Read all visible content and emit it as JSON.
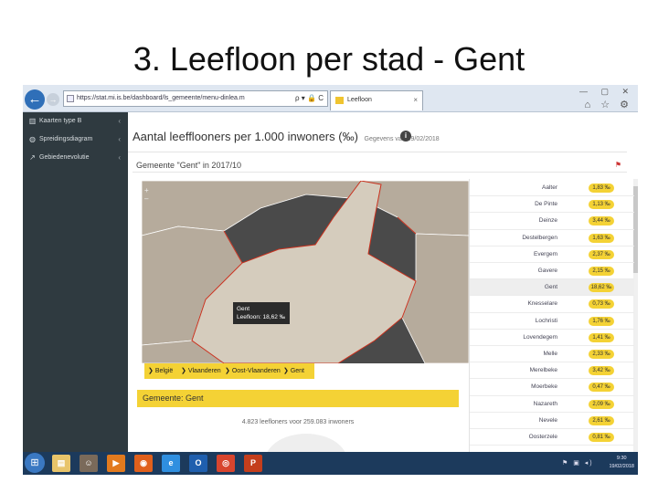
{
  "slide": {
    "title": "3. Leefloon per stad - Gent"
  },
  "browser": {
    "url": "https://stat.mi.is.be/dashboard/ls_gemeente/menu-dinlea.m",
    "tab_title": "Leefloon",
    "tab_close": "×",
    "url_tools": "ρ ▾ 🔒 C",
    "window_controls": "— ▢ ✕",
    "right_icons": "⌂ ☆ ⚙"
  },
  "sidebar": {
    "items": [
      {
        "icon": "map-icon",
        "label": "Kaarten type B"
      },
      {
        "icon": "gauge-icon",
        "label": "Spreidingsdiagram"
      },
      {
        "icon": "trend-icon",
        "label": "Gebiedenevolutie"
      }
    ]
  },
  "page": {
    "heading": "Aantal leefflooners per 1.000 inwoners (‰)",
    "subheading": "Gegevens van 19/02/2018",
    "panel_title": "Gemeente \"Gent\" in 2017/10"
  },
  "map": {
    "zoom_in": "+",
    "zoom_out": "–",
    "tooltip_line1": "Gent",
    "tooltip_line2": "Leefloon: 18,62 ‰",
    "colors": {
      "background": "#4a4a4a",
      "region": "#b6ab9c",
      "selected": "#d5ccbd",
      "border": "#c9311e"
    }
  },
  "breadcrumbs": [
    {
      "label": "België"
    },
    {
      "label": "Vlaanderen"
    },
    {
      "label": "Oost-Vlaanderen"
    },
    {
      "label": "Gent"
    }
  ],
  "region_bar": {
    "label": "Gemeente: Gent"
  },
  "summary": {
    "text": "4.823 leefloners voor 259.083 inwoners"
  },
  "table": {
    "rows": [
      {
        "city": "Aalter",
        "value": "1,83 ‰"
      },
      {
        "city": "De Pinte",
        "value": "1,13 ‰"
      },
      {
        "city": "Deinze",
        "value": "3,44 ‰"
      },
      {
        "city": "Destelbergen",
        "value": "1,63 ‰"
      },
      {
        "city": "Evergem",
        "value": "2,37 ‰"
      },
      {
        "city": "Gavere",
        "value": "2,15 ‰"
      },
      {
        "city": "Gent",
        "value": "18,62 ‰",
        "selected": true
      },
      {
        "city": "Knesselare",
        "value": "0,73 ‰"
      },
      {
        "city": "Lochristi",
        "value": "1,76 ‰"
      },
      {
        "city": "Lovendegem",
        "value": "1,41 ‰"
      },
      {
        "city": "Melle",
        "value": "2,33 ‰"
      },
      {
        "city": "Merelbeke",
        "value": "3,42 ‰"
      },
      {
        "city": "Moerbeke",
        "value": "0,47 ‰"
      },
      {
        "city": "Nazareth",
        "value": "2,09 ‰"
      },
      {
        "city": "Nevele",
        "value": "2,61 ‰"
      },
      {
        "city": "Oosterzele",
        "value": "0,81 ‰"
      }
    ]
  },
  "taskbar": {
    "apps": [
      {
        "name": "explorer",
        "glyph": "▤",
        "color": "#e8c46a"
      },
      {
        "name": "user",
        "glyph": "☺",
        "color": "#7a6a5a"
      },
      {
        "name": "media",
        "glyph": "▶",
        "color": "#e27a1e"
      },
      {
        "name": "firefox",
        "glyph": "◉",
        "color": "#e0601c"
      },
      {
        "name": "ie",
        "glyph": "e",
        "color": "#2f8fe0"
      },
      {
        "name": "outlook",
        "glyph": "O",
        "color": "#1f5fae"
      },
      {
        "name": "chrome",
        "glyph": "◎",
        "color": "#d8452e"
      },
      {
        "name": "powerpoint",
        "glyph": "P",
        "color": "#c43e1c"
      }
    ],
    "tray": "⚑ ▣ ◂)",
    "clock_time": "9:30",
    "clock_date": "19/02/2018"
  }
}
